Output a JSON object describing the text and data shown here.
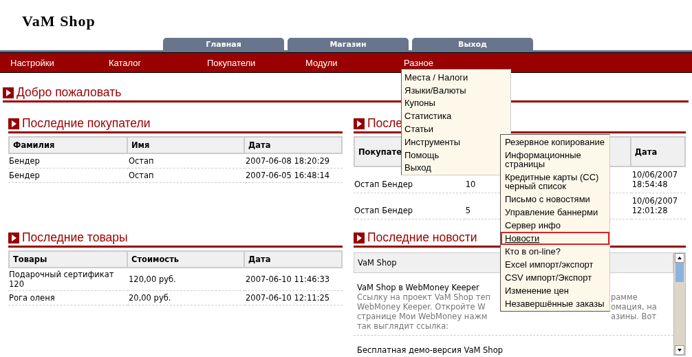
{
  "logo": "VaM Shop",
  "tabs": [
    {
      "label": "Главная"
    },
    {
      "label": "Магазин"
    },
    {
      "label": "Выход"
    }
  ],
  "menu_bar": [
    {
      "label": "Настройки"
    },
    {
      "label": "Каталог"
    },
    {
      "label": "Покупатели"
    },
    {
      "label": "Модули"
    },
    {
      "label": "Разное",
      "children": [
        {
          "label": "Места / Налоги"
        },
        {
          "label": "Языки/Валюты"
        },
        {
          "label": "Купоны"
        },
        {
          "label": "Статистика"
        },
        {
          "label": "Статьи"
        },
        {
          "label": "Инструменты",
          "children": [
            {
              "label": "Резервное копирование",
              "selected": false
            },
            {
              "label": "Информационные страницы",
              "selected": false
            },
            {
              "label": "Кредитные карты (CC) черный список",
              "selected": false
            },
            {
              "label": "Письмо с новостями",
              "selected": false
            },
            {
              "label": "Управление баннерми",
              "selected": false
            },
            {
              "label": "Сервер инфо",
              "selected": false
            },
            {
              "label": "Новости",
              "selected": true
            },
            {
              "label": "Кто в on-line?",
              "selected": false
            },
            {
              "label": "Excel импорт/экспорт",
              "selected": false
            },
            {
              "label": "CSV импорт/Экспорт",
              "selected": false
            },
            {
              "label": "Изменение цен",
              "selected": false
            },
            {
              "label": "Незавершённые заказы",
              "selected": false
            }
          ]
        },
        {
          "label": "Помощь"
        },
        {
          "label": "Выход"
        }
      ]
    }
  ],
  "welcome": {
    "title": "Добро пожаловать"
  },
  "recent_customers": {
    "title": "Последние покупатели",
    "columns": [
      "Фамилия",
      "Имя",
      "Дата"
    ],
    "rows": [
      [
        "Бендер",
        "Остап",
        "2007-06-08 18:20:29"
      ],
      [
        "Бендер",
        "Остап",
        "2007-06-05 16:48:14"
      ]
    ]
  },
  "recent_orders": {
    "title": "После",
    "columns": {
      "column_1": "Покупате",
      "date": "Дата"
    },
    "rows": [
      {
        "customer": "Остап Бендер",
        "column_2": "10",
        "date": "10/06/2007 18:54:48"
      },
      {
        "customer": "Остап Бендер",
        "column_2": "5",
        "date": "10/06/2007 12:01:28"
      }
    ]
  },
  "recent_products": {
    "title": "Последние товары",
    "columns": [
      "Товары",
      "Стоимость",
      "Дата"
    ],
    "rows": [
      [
        "Подарочный сертификат 120",
        "120,00 руб.",
        "2007-06-10 11:46:33"
      ],
      [
        "Рога оленя",
        "20,00 руб.",
        "2007-06-10 12:11:25"
      ]
    ]
  },
  "recent_news": {
    "title": "Последние новости",
    "header": "VaM Shop",
    "items": [
      {
        "title": "VaM Shop в WebMoney Keeper",
        "lines": [
          {
            "left": "Ссылку на проект VaM Shop теп",
            "right": "рамме"
          },
          {
            "left": "WebMoney Keeper. Откройте W",
            "right": "омация, на"
          },
          {
            "left": "странице Мои WebMoney нажм",
            "right": "азины. Вот"
          },
          {
            "left": "так выглядит ссылка:"
          }
        ]
      },
      {
        "title": "Бесплатная демо-версия VaM Shop"
      }
    ]
  }
}
